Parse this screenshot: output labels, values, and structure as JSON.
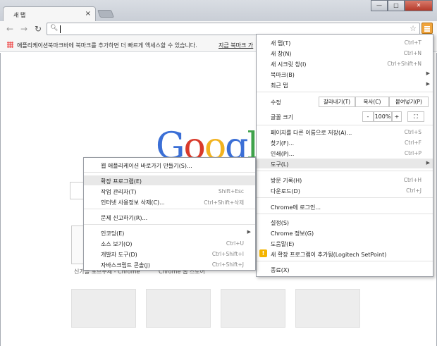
{
  "tab": {
    "title": "새 탭",
    "close": "×"
  },
  "window_buttons": {
    "minimize": "—",
    "maximize": "□",
    "close": "✕"
  },
  "omnibox": {
    "value": ""
  },
  "bookmarks": {
    "apps": "애플리케이션",
    "hint": "북마크바에 북마크를 추가하면 더 빠르게 액세스할 수 있습니다.",
    "link": "지금 북마크 가"
  },
  "thumbnails": {
    "label1": "신가을 포브무제 - Chrome",
    "label2": "Chrome 웹 스토어"
  },
  "menu": {
    "new_tab": "새 탭(T)",
    "new_tab_sc": "Ctrl+T",
    "new_window": "새 창(N)",
    "new_window_sc": "Ctrl+N",
    "incognito": "새 시크릿 창(I)",
    "incognito_sc": "Ctrl+Shift+N",
    "bookmarks": "북마크(B)",
    "recent_tabs": "최근 탭",
    "edit": "수정",
    "cut": "잘라내기(T)",
    "copy": "복사(C)",
    "paste": "붙여넣기(P)",
    "zoom": "글꼴 크기",
    "zoom_minus": "-",
    "zoom_value": "100%",
    "zoom_plus": "+",
    "fullscreen": "⛶",
    "save_as": "페이지를 다른 이름으로 저장(A)...",
    "save_as_sc": "Ctrl+S",
    "find": "찾기(F)...",
    "find_sc": "Ctrl+F",
    "print": "인쇄(P)...",
    "print_sc": "Ctrl+P",
    "tools": "도구(L)",
    "history": "방문 기록(H)",
    "history_sc": "Ctrl+H",
    "downloads": "다운로드(D)",
    "downloads_sc": "Ctrl+J",
    "signin": "Chrome에 로그인...",
    "settings": "설정(S)",
    "about": "Chrome 정보(G)",
    "help": "도움말(E)",
    "ext_added": "새 확장 프로그램이 추가됨(Logitech SetPoint)",
    "exit": "종료(X)"
  },
  "submenu": {
    "create_shortcuts": "웹 애플리케이션 바로가기 만들기(S)...",
    "extensions": "확장 프로그램(E)",
    "task_manager": "작업 관리자(T)",
    "task_manager_sc": "Shift+Esc",
    "clear_data": "인터넷 사용정보 삭제(C)...",
    "clear_data_sc": "Ctrl+Shift+삭제",
    "report_issue": "문제 신고하기(R)...",
    "encoding": "인코딩(E)",
    "view_source": "소스 보기(O)",
    "view_source_sc": "Ctrl+U",
    "dev_tools": "개발자 도구(D)",
    "dev_tools_sc": "Ctrl+Shift+I",
    "js_console": "자바스크립트 콘솔(J)",
    "js_console_sc": "Ctrl+Shift+J"
  },
  "colors": {
    "menu_button": "#f0a33a",
    "highlight": "#e8e8e8",
    "warning": "#f4b400"
  }
}
